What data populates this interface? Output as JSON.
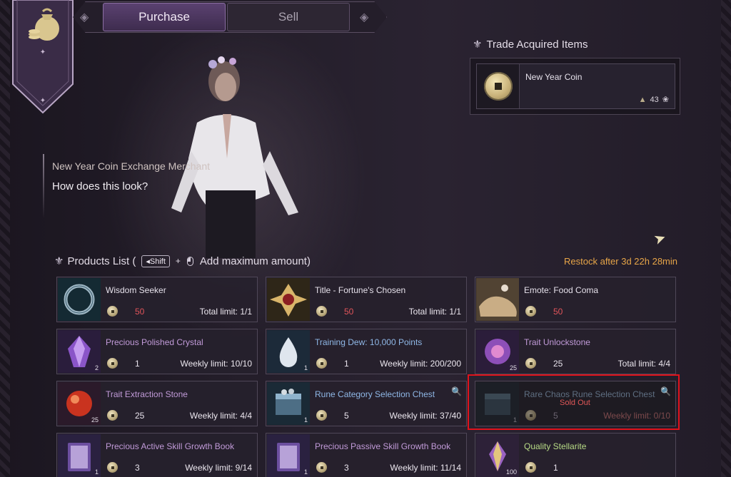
{
  "tabs": {
    "purchase": "Purchase",
    "sell": "Sell"
  },
  "trade": {
    "title": "Trade Acquired Items",
    "item_name": "New Year Coin",
    "item_count": "43"
  },
  "npc": {
    "name": "New Year Coin Exchange Merchant",
    "line": "How does this look?"
  },
  "products_header": {
    "title": "Products List (",
    "key": "Shift",
    "plus": "+",
    "hint": "Add maximum amount)",
    "restock": "Restock after 3d 22h 28min"
  },
  "products": [
    {
      "name": "Wisdom Seeker",
      "price": "50",
      "limit": "Total limit: 1/1",
      "qty": ""
    },
    {
      "name": "Title - Fortune's Chosen",
      "price": "50",
      "limit": "Total limit: 1/1",
      "qty": ""
    },
    {
      "name": "Emote: Food Coma",
      "price": "50",
      "limit": "",
      "qty": ""
    },
    {
      "name": "Precious Polished Crystal",
      "price": "1",
      "limit": "Weekly limit: 10/10",
      "qty": "2"
    },
    {
      "name": "Training Dew: 10,000 Points",
      "price": "1",
      "limit": "Weekly limit: 200/200",
      "qty": "1"
    },
    {
      "name": "Trait Unlockstone",
      "price": "25",
      "limit": "Total limit: 4/4",
      "qty": "25"
    },
    {
      "name": "Trait Extraction Stone",
      "price": "25",
      "limit": "Weekly limit: 4/4",
      "qty": "25"
    },
    {
      "name": "Rune Category Selection Chest",
      "price": "5",
      "limit": "Weekly limit: 37/40",
      "qty": "1"
    },
    {
      "name": "Rare Chaos Rune Selection Chest",
      "price": "5",
      "limit": "Weekly limit: 0/10",
      "qty": "1",
      "status": "Sold Out"
    },
    {
      "name": "Precious Active Skill Growth Book",
      "price": "3",
      "limit": "Weekly limit: 9/14",
      "qty": "1"
    },
    {
      "name": "Precious Passive Skill Growth Book",
      "price": "3",
      "limit": "Weekly limit: 11/14",
      "qty": "1"
    },
    {
      "name": "Quality Stellarite",
      "price": "1",
      "limit": "",
      "qty": "100"
    }
  ],
  "colors": {
    "accent": "#e7a548",
    "price_red": "#e0545a",
    "highlight": "#e0121b"
  }
}
